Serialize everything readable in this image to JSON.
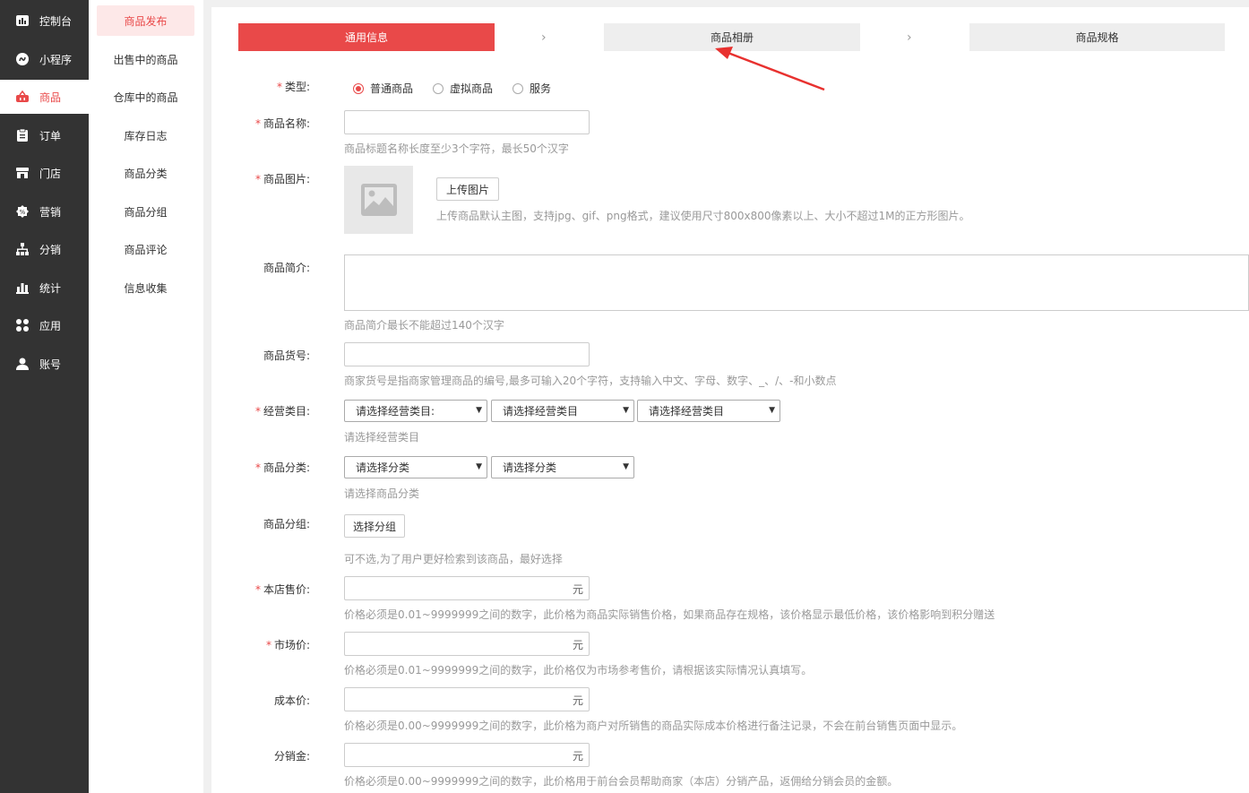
{
  "sidebar": {
    "items": [
      {
        "label": "控制台",
        "icon": "dashboard-icon"
      },
      {
        "label": "小程序",
        "icon": "mini-program-icon"
      },
      {
        "label": "商品",
        "icon": "shopping-basket-icon"
      },
      {
        "label": "订单",
        "icon": "clipboard-icon"
      },
      {
        "label": "门店",
        "icon": "store-icon"
      },
      {
        "label": "营销",
        "icon": "marketing-icon"
      },
      {
        "label": "分销",
        "icon": "distribution-icon"
      },
      {
        "label": "统计",
        "icon": "bar-chart-icon"
      },
      {
        "label": "应用",
        "icon": "apps-icon"
      },
      {
        "label": "账号",
        "icon": "user-icon"
      }
    ],
    "active_index": 2
  },
  "submenu": {
    "items": [
      "商品发布",
      "出售中的商品",
      "仓库中的商品",
      "库存日志",
      "商品分类",
      "商品分组",
      "商品评论",
      "信息收集"
    ],
    "active_index": 0
  },
  "steps": {
    "general": "通用信息",
    "album": "商品相册",
    "spec": "商品规格",
    "chevron": "›"
  },
  "form": {
    "required_mark": "*",
    "type_label": "类型:",
    "type_options": [
      "普通商品",
      "虚拟商品",
      "服务"
    ],
    "type_selected": "普通商品",
    "name_label": "商品名称:",
    "name_hint": "商品标题名称长度至少3个字符，最长50个汉字",
    "image_label": "商品图片:",
    "upload_button": "上传图片",
    "image_hint": "上传商品默认主图，支持jpg、gif、png格式，建议使用尺寸800x800像素以上、大小不超过1M的正方形图片。",
    "intro_label": "商品简介:",
    "intro_hint": "商品简介最长不能超过140个汉字",
    "sku_label": "商品货号:",
    "sku_hint": "商家货号是指商家管理商品的编号,最多可输入20个字符，支持输入中文、字母、数字、_、/、-和小数点",
    "category_label": "经营类目:",
    "category_selects": [
      "请选择经营类目:",
      "请选择经营类目",
      "请选择经营类目"
    ],
    "category_hint": "请选择经营类目",
    "classify_label": "商品分类:",
    "classify_selects": [
      "请选择分类",
      "请选择分类"
    ],
    "classify_hint": "请选择商品分类",
    "group_label": "商品分组:",
    "group_button": "选择分组",
    "group_hint": "可不选,为了用户更好检索到该商品，最好选择",
    "price_label": "本店售价:",
    "price_unit": "元",
    "price_hint": "价格必须是0.01~9999999之间的数字，此价格为商品实际销售价格，如果商品存在规格，该价格显示最低价格，该价格影响到积分赠送",
    "market_label": "市场价:",
    "market_unit": "元",
    "market_hint": "价格必须是0.01~9999999之间的数字，此价格仅为市场参考售价，请根据该实际情况认真填写。",
    "cost_label": "成本价:",
    "cost_unit": "元",
    "cost_hint": "价格必须是0.00~9999999之间的数字，此价格为商户对所销售的商品实际成本价格进行备注记录，不会在前台销售页面中显示。",
    "commission_label": "分销金:",
    "commission_unit": "元",
    "commission_hint": "价格必须是0.00~9999999之间的数字，此价格用于前台会员帮助商家（本店）分销产品，返佣给分销会员的金额。"
  },
  "colors": {
    "accent": "#e94949",
    "sidebar_bg": "#333333"
  }
}
